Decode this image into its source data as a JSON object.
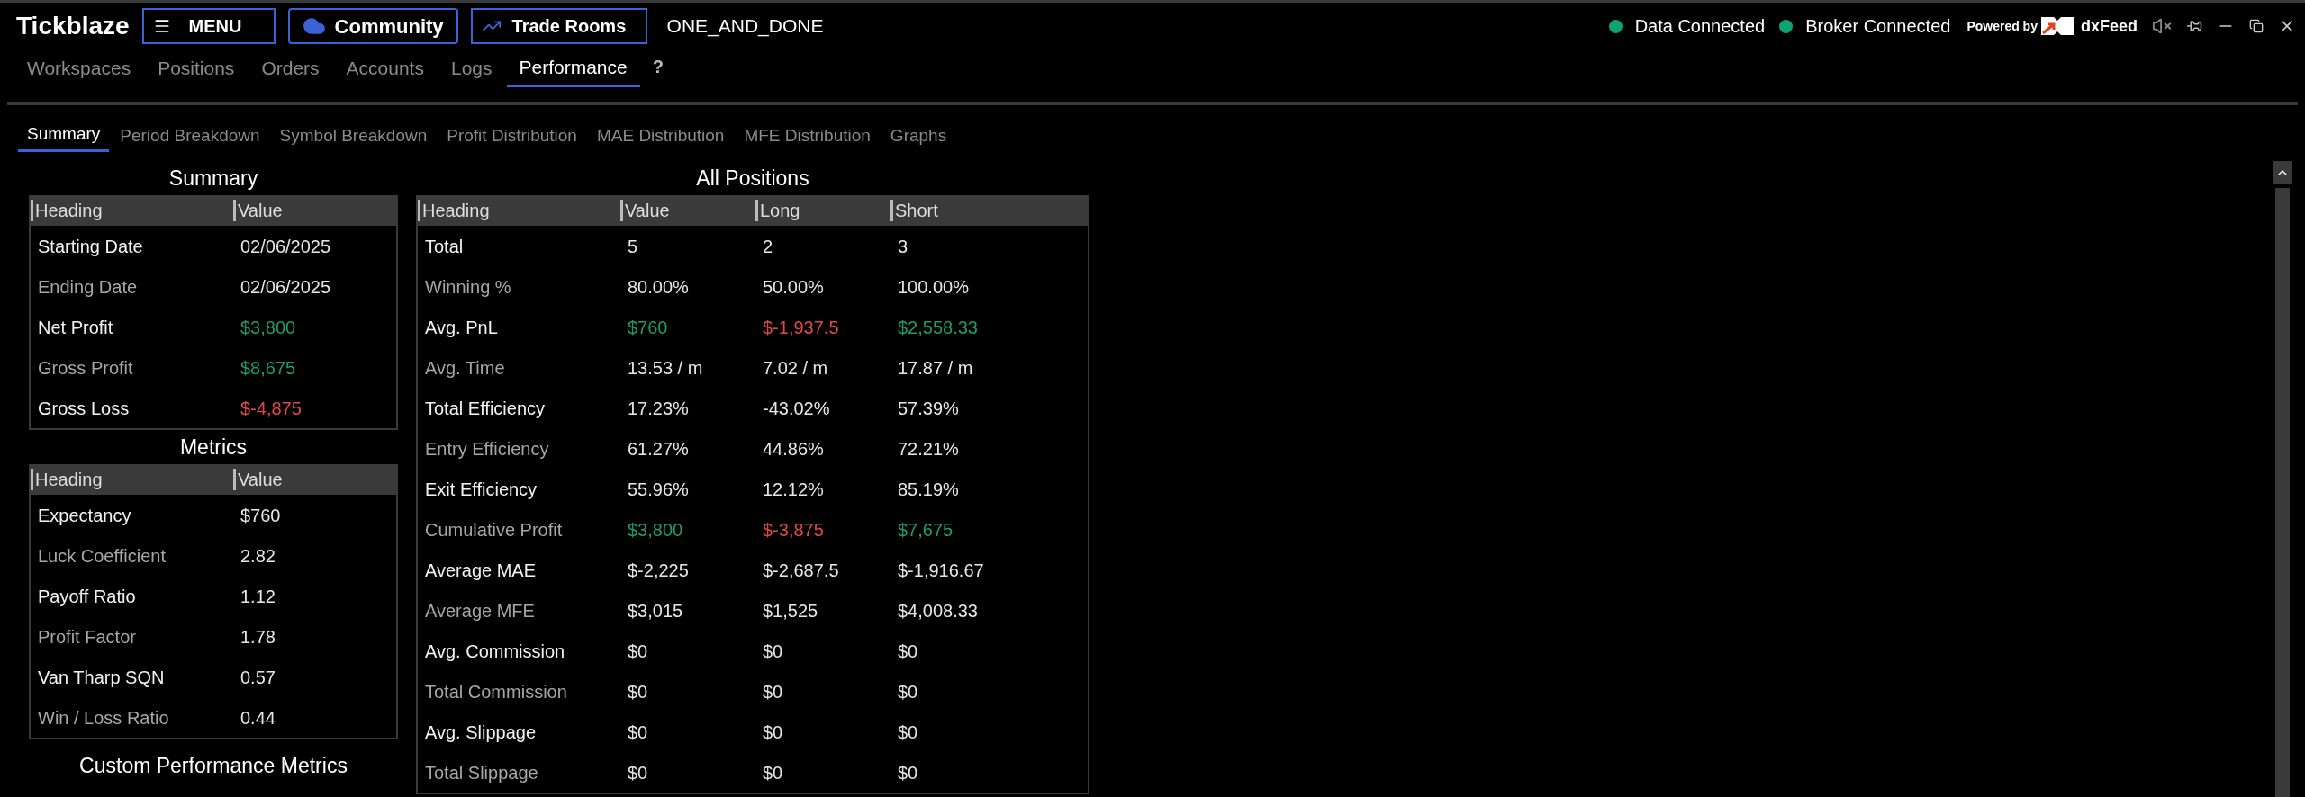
{
  "app": {
    "logo": "Tickblaze",
    "menu": "MENU",
    "community": "Community",
    "trade_rooms": "Trade Rooms",
    "account": "ONE_AND_DONE"
  },
  "status": [
    {
      "label": "Data Connected",
      "color": "#0ea371"
    },
    {
      "label": "Broker Connected",
      "color": "#0ea371"
    }
  ],
  "powered_by": {
    "label": "Powered by",
    "brand": "dxFeed"
  },
  "nav_tabs": [
    {
      "label": "Workspaces",
      "selected": false
    },
    {
      "label": "Positions",
      "selected": false
    },
    {
      "label": "Orders",
      "selected": false
    },
    {
      "label": "Accounts",
      "selected": false
    },
    {
      "label": "Logs",
      "selected": false
    },
    {
      "label": "Performance",
      "selected": true
    }
  ],
  "help": "?",
  "sub_tabs": [
    {
      "label": "Summary",
      "selected": true
    },
    {
      "label": "Period Breakdown",
      "selected": false
    },
    {
      "label": "Symbol Breakdown",
      "selected": false
    },
    {
      "label": "Profit Distribution",
      "selected": false
    },
    {
      "label": "MAE Distribution",
      "selected": false
    },
    {
      "label": "MFE Distribution",
      "selected": false
    },
    {
      "label": "Graphs",
      "selected": false
    }
  ],
  "summary": {
    "title": "Summary",
    "columns": [
      "Heading",
      "Value"
    ],
    "rows": [
      {
        "cells": [
          "Starting Date",
          "02/06/2025"
        ]
      },
      {
        "cells": [
          "Ending Date",
          "02/06/2025"
        ]
      },
      {
        "cells": [
          "Net Profit",
          {
            "text": "$3,800",
            "color": "#1e9b6c"
          }
        ]
      },
      {
        "cells": [
          "Gross Profit",
          {
            "text": "$8,675",
            "color": "#1e9b6c"
          }
        ]
      },
      {
        "cells": [
          "Gross Loss",
          {
            "text": "$-4,875",
            "color": "#e04848"
          }
        ]
      }
    ]
  },
  "metrics": {
    "title": "Metrics",
    "columns": [
      "Heading",
      "Value"
    ],
    "rows": [
      {
        "cells": [
          "Expectancy",
          "$760"
        ]
      },
      {
        "cells": [
          "Luck Coefficient",
          "2.82"
        ]
      },
      {
        "cells": [
          "Payoff Ratio",
          "1.12"
        ]
      },
      {
        "cells": [
          "Profit Factor",
          "1.78"
        ]
      },
      {
        "cells": [
          "Van Tharp SQN",
          "0.57"
        ]
      },
      {
        "cells": [
          "Win / Loss Ratio",
          "0.44"
        ]
      }
    ]
  },
  "custom_metrics": {
    "title": "Custom Performance Metrics"
  },
  "all_positions": {
    "title": "All Positions",
    "columns": [
      "Heading",
      "Value",
      "Long",
      "Short"
    ],
    "rows": [
      {
        "cells": [
          "Total",
          "5",
          "2",
          "3"
        ]
      },
      {
        "cells": [
          "Winning %",
          "80.00%",
          "50.00%",
          "100.00%"
        ]
      },
      {
        "cells": [
          "Avg. PnL",
          {
            "text": "$760",
            "color": "#1e9b6c"
          },
          {
            "text": "$-1,937.5",
            "color": "#e04848"
          },
          {
            "text": "$2,558.33",
            "color": "#1e9b6c"
          }
        ]
      },
      {
        "cells": [
          "Avg. Time",
          "13.53 / m",
          "7.02 / m",
          "17.87 / m"
        ]
      },
      {
        "cells": [
          "Total Efficiency",
          "17.23%",
          "-43.02%",
          "57.39%"
        ]
      },
      {
        "cells": [
          "Entry Efficiency",
          "61.27%",
          "44.86%",
          "72.21%"
        ]
      },
      {
        "cells": [
          "Exit Efficiency",
          "55.96%",
          "12.12%",
          "85.19%"
        ]
      },
      {
        "cells": [
          "Cumulative Profit",
          {
            "text": "$3,800",
            "color": "#1e9b6c"
          },
          {
            "text": "$-3,875",
            "color": "#e04848"
          },
          {
            "text": "$7,675",
            "color": "#1e9b6c"
          }
        ]
      },
      {
        "cells": [
          "Average MAE",
          "$-2,225",
          "$-2,687.5",
          "$-1,916.67"
        ]
      },
      {
        "cells": [
          "Average MFE",
          "$3,015",
          "$1,525",
          "$4,008.33"
        ]
      },
      {
        "cells": [
          "Avg. Commission",
          "$0",
          "$0",
          "$0"
        ]
      },
      {
        "cells": [
          "Total Commission",
          "$0",
          "$0",
          "$0"
        ]
      },
      {
        "cells": [
          "Avg. Slippage",
          "$0",
          "$0",
          "$0"
        ]
      },
      {
        "cells": [
          "Total Slippage",
          "$0",
          "$0",
          "$0"
        ]
      }
    ]
  }
}
